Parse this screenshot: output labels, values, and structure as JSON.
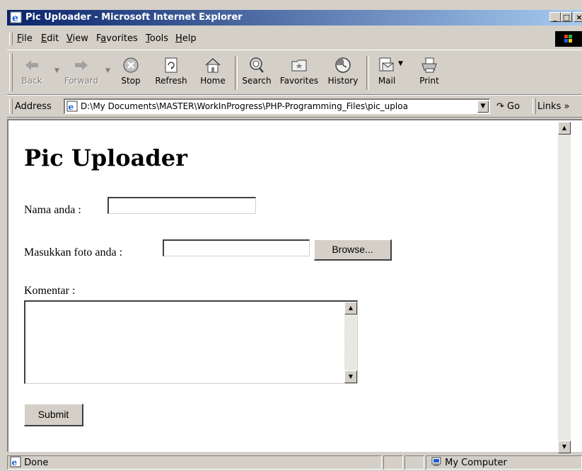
{
  "window": {
    "title": "Pic Uploader - Microsoft Internet Explorer",
    "minimize": "_",
    "maximize": "□",
    "close": "×"
  },
  "menu": [
    "File",
    "Edit",
    "View",
    "Favorites",
    "Tools",
    "Help"
  ],
  "menu_underline": [
    "F",
    "E",
    "V",
    "a",
    "T",
    "H"
  ],
  "toolbar": {
    "back": "Back",
    "forward": "Forward",
    "stop": "Stop",
    "refresh": "Refresh",
    "home": "Home",
    "search": "Search",
    "favorites": "Favorites",
    "history": "History",
    "mail": "Mail",
    "print": "Print"
  },
  "address": {
    "label": "Address",
    "url": "D:\\My Documents\\MASTER\\WorkInProgress\\PHP-Programming_Files\\pic_uploa",
    "go": "Go",
    "links": "Links »"
  },
  "page": {
    "heading": "Pic Uploader",
    "name_label": "Nama anda  :",
    "name_value": "",
    "photo_label": "Masukkan foto anda  :",
    "photo_value": "",
    "browse_label": "Browse...",
    "comment_label": "Komentar :",
    "comment_value": "",
    "submit_label": "Submit"
  },
  "status": {
    "text": "Done",
    "zone": "My Computer"
  },
  "icons": [
    "ie-logo-icon",
    "back-icon",
    "forward-icon",
    "stop-icon",
    "refresh-icon",
    "home-icon",
    "search-icon",
    "favorites-icon",
    "history-icon",
    "mail-icon",
    "print-icon",
    "page-icon",
    "go-icon",
    "computer-icon",
    "windows-flag-icon"
  ]
}
